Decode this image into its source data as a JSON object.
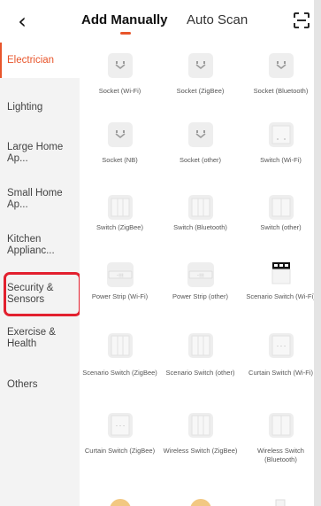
{
  "header": {
    "back_icon": "chevron-left-icon",
    "tabs": [
      {
        "label": "Add Manually",
        "active": true
      },
      {
        "label": "Auto Scan",
        "active": false
      }
    ],
    "scan_icon": "scan-qr-icon"
  },
  "sidebar": {
    "items": [
      {
        "label": "Electrician",
        "active": true
      },
      {
        "label": "Lighting"
      },
      {
        "label": "Large Home Ap..."
      },
      {
        "label": "Small Home Ap..."
      },
      {
        "label": "Kitchen Applianc..."
      },
      {
        "label": "Security & Sensors",
        "highlighted": true
      },
      {
        "label": "Exercise & Health"
      },
      {
        "label": "Others"
      }
    ]
  },
  "devices": [
    {
      "name": "Socket (Wi-Fi)",
      "icon": "socket-icon"
    },
    {
      "name": "Socket (ZigBee)",
      "icon": "socket-icon"
    },
    {
      "name": "Socket (Bluetooth)",
      "icon": "socket-icon"
    },
    {
      "name": "Socket (NB)",
      "icon": "socket-icon"
    },
    {
      "name": "Socket (other)",
      "icon": "socket-icon"
    },
    {
      "name": "Switch (Wi-Fi)",
      "icon": "switch-icon"
    },
    {
      "name": "Switch (ZigBee)",
      "icon": "switch-icon"
    },
    {
      "name": "Switch (Bluetooth)",
      "icon": "switch-icon"
    },
    {
      "name": "Switch (other)",
      "icon": "switch-icon"
    },
    {
      "name": "Power Strip (Wi-Fi)",
      "icon": "power-strip-icon"
    },
    {
      "name": "Power Strip (other)",
      "icon": "power-strip-icon"
    },
    {
      "name": "Scenario Switch (Wi-Fi)",
      "icon": "scenario-switch-icon"
    },
    {
      "name": "Scenario Switch (ZigBee)",
      "icon": "scenario-switch-icon"
    },
    {
      "name": "Scenario Switch (other)",
      "icon": "scenario-switch-icon"
    },
    {
      "name": "Curtain Switch (Wi-Fi)",
      "icon": "curtain-switch-icon"
    },
    {
      "name": "Curtain Switch (ZigBee)",
      "icon": "curtain-switch-icon"
    },
    {
      "name": "Wireless Switch (ZigBee)",
      "icon": "wireless-switch-icon"
    },
    {
      "name": "Wireless Switch (Bluetooth)",
      "icon": "wireless-switch-icon"
    }
  ],
  "colors": {
    "accent": "#e8552b",
    "highlight_box": "#e2202e"
  }
}
